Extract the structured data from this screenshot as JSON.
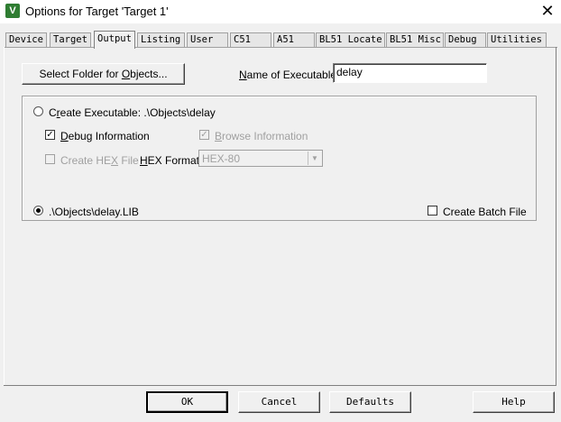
{
  "window": {
    "title": "Options for Target 'Target 1'",
    "close_glyph": "✕",
    "icon": "uvision-icon"
  },
  "tabs": [
    {
      "label": "Device"
    },
    {
      "label": "Target"
    },
    {
      "label": "Output"
    },
    {
      "label": "Listing"
    },
    {
      "label": "User"
    },
    {
      "label": "C51"
    },
    {
      "label": "A51"
    },
    {
      "label": "BL51 Locate"
    },
    {
      "label": "BL51 Misc"
    },
    {
      "label": "Debug"
    },
    {
      "label": "Utilities"
    }
  ],
  "output": {
    "select_folder_pre": "Select Folder for ",
    "select_folder_ul": "O",
    "select_folder_post": "bjects...",
    "name_exec_ul": "N",
    "name_exec_rest": "ame of Executable:",
    "name_exec_value": "delay",
    "create_exec_pre": "C",
    "create_exec_ul": "r",
    "create_exec_rest": "eate Executable:  .\\Objects\\delay",
    "debug_ul": "D",
    "debug_rest": "ebug Information",
    "debug_checked": true,
    "browse_ul": "B",
    "browse_rest": "rowse Information",
    "browse_checked": true,
    "create_hex_pre": "Create HE",
    "create_hex_ul": "X",
    "create_hex_rest": " File",
    "create_hex_checked": false,
    "hex_format_ul": "H",
    "hex_format_rest": "EX Format:",
    "hex_format_value": "HEX-80",
    "lib_label": ".\\Objects\\delay.LIB",
    "create_lib_selected": true,
    "create_exec_selected": false,
    "batch_label": "Create Batch File",
    "batch_checked": false,
    "check_glyph": "✓",
    "arrow_glyph": "▼"
  },
  "footer": {
    "ok": "OK",
    "cancel": "Cancel",
    "defaults": "Defaults",
    "help": "Help"
  }
}
